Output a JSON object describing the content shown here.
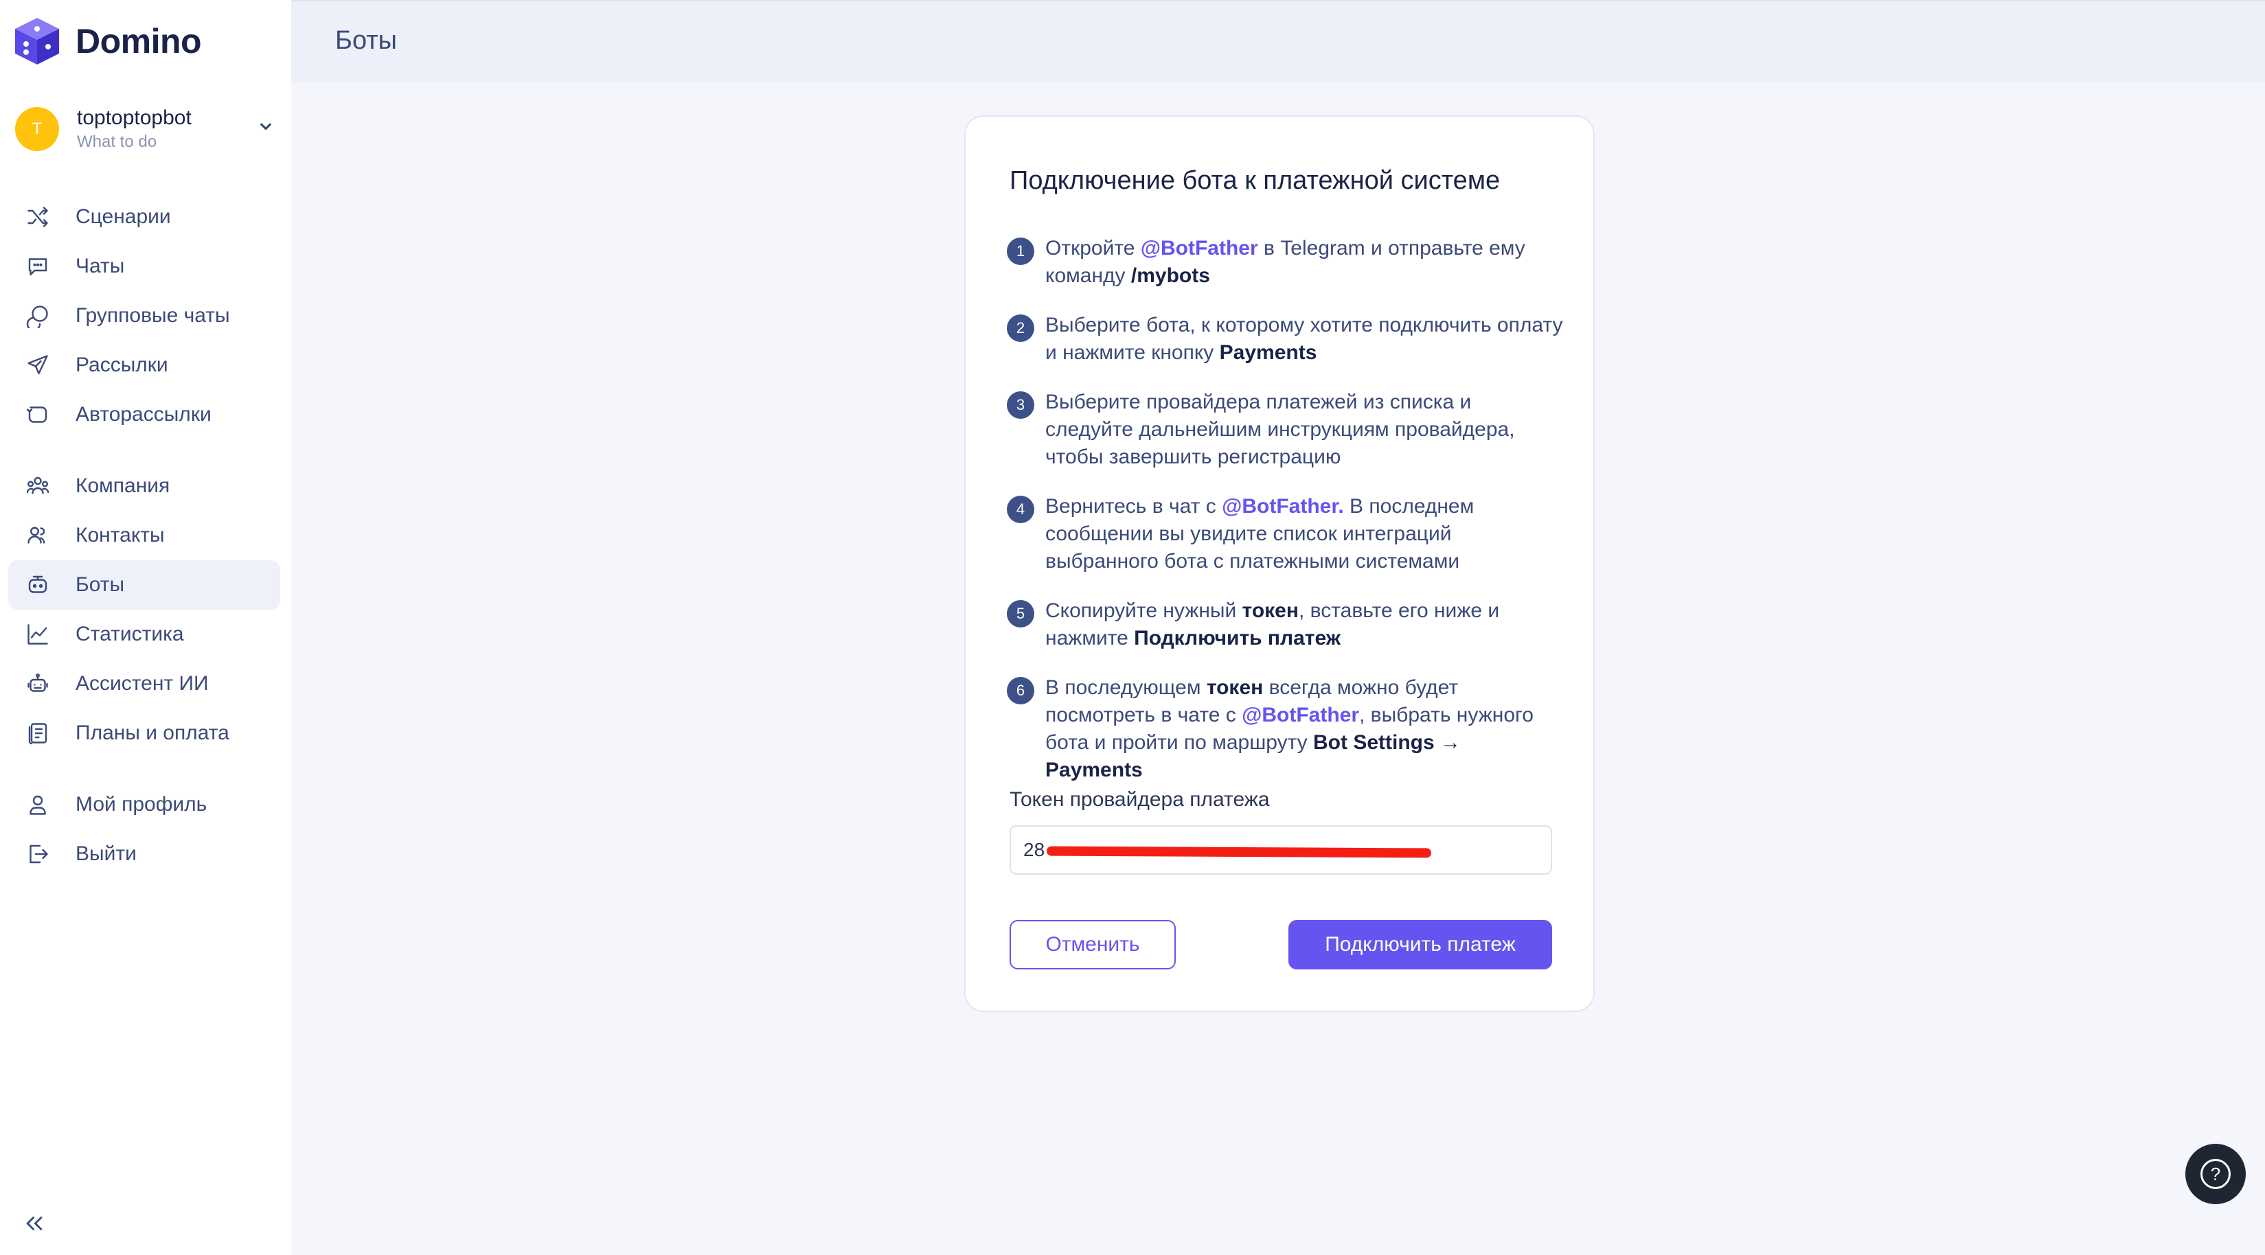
{
  "app": {
    "name": "Domino"
  },
  "account": {
    "initial": "T",
    "name": "toptoptopbot",
    "subtitle": "What to do"
  },
  "sidebar": {
    "items": [
      {
        "label": "Сценарии",
        "icon": "shuffle-icon"
      },
      {
        "label": "Чаты",
        "icon": "chat-icon"
      },
      {
        "label": "Групповые чаты",
        "icon": "group-chat-icon"
      },
      {
        "label": "Рассылки",
        "icon": "send-icon"
      },
      {
        "label": "Авторассылки",
        "icon": "auto-send-icon"
      },
      {
        "label": "Компания",
        "icon": "company-icon"
      },
      {
        "label": "Контакты",
        "icon": "contacts-icon"
      },
      {
        "label": "Боты",
        "icon": "bot-icon",
        "active": true
      },
      {
        "label": "Статистика",
        "icon": "stats-icon"
      },
      {
        "label": "Ассистент ИИ",
        "icon": "ai-assistant-icon"
      },
      {
        "label": "Планы и оплата",
        "icon": "billing-icon"
      },
      {
        "label": "Мой профиль",
        "icon": "profile-icon"
      },
      {
        "label": "Выйти",
        "icon": "logout-icon"
      }
    ]
  },
  "header": {
    "title": "Боты"
  },
  "card": {
    "title": "Подключение бота к платежной системе",
    "steps": [
      {
        "num": "1",
        "parts": [
          "Откройте ",
          "@BotFather",
          " в Telegram и отправьте ему команду ",
          "/mybots"
        ]
      },
      {
        "num": "2",
        "parts": [
          "Выберите бота, к которому хотите подключить оплату и нажмите кнопку ",
          "Payments"
        ]
      },
      {
        "num": "3",
        "parts": [
          "Выберите провайдера платежей из списка и следуйте дальнейшим инструкциям провайдера, чтобы завершить регистрацию"
        ]
      },
      {
        "num": "4",
        "parts": [
          "Вернитесь в чат с ",
          "@BotFather.",
          " В последнем сообщении вы увидите список интеграций выбранного бота с платежными системами"
        ]
      },
      {
        "num": "5",
        "parts": [
          "Скопируйте нужный ",
          "токен",
          ", вставьте его ниже и нажмите ",
          "Подключить платеж"
        ]
      },
      {
        "num": "6",
        "parts": [
          "В последующем ",
          "токен",
          " всегда можно будет посмотреть в чате с ",
          "@BotFather",
          ", выбрать нужного бота и пройти по маршруту ",
          "Bot Settings → Payments"
        ]
      }
    ],
    "token_label": "Токен провайдера платежа",
    "token_value": "28",
    "cancel_label": "Отменить",
    "connect_label": "Подключить платеж"
  },
  "help": {
    "label": "?"
  },
  "colors": {
    "accent": "#6554f0",
    "avatar": "#ffc20d",
    "redaction": "#f41f14"
  }
}
